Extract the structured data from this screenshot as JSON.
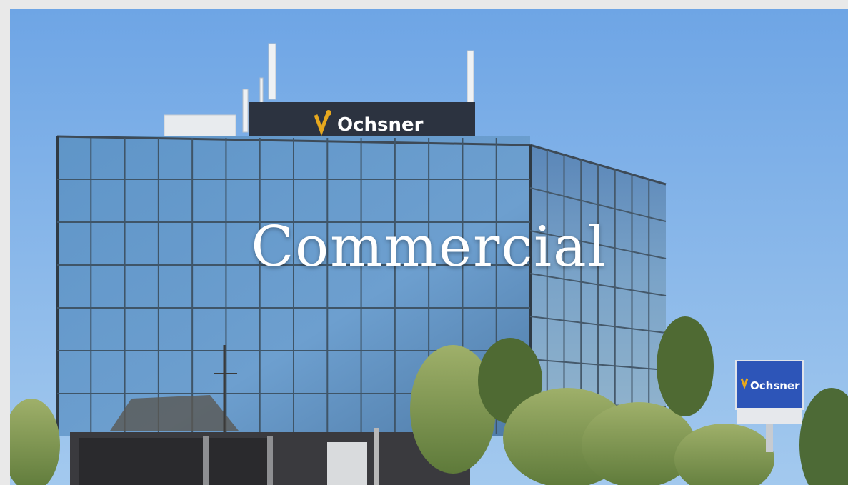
{
  "tile": {
    "title": "Commercial",
    "image": {
      "rooftop_sign": "Ochsner",
      "street_sign": "Ochsner"
    }
  },
  "colors": {
    "sky_top": "#6fa6e6",
    "sky_bottom": "#9cc6ee",
    "glass": "#5f8fbf",
    "sign_blue": "#2d55b8",
    "logo_gold": "#e6a81e",
    "title_text": "#ffffff"
  }
}
